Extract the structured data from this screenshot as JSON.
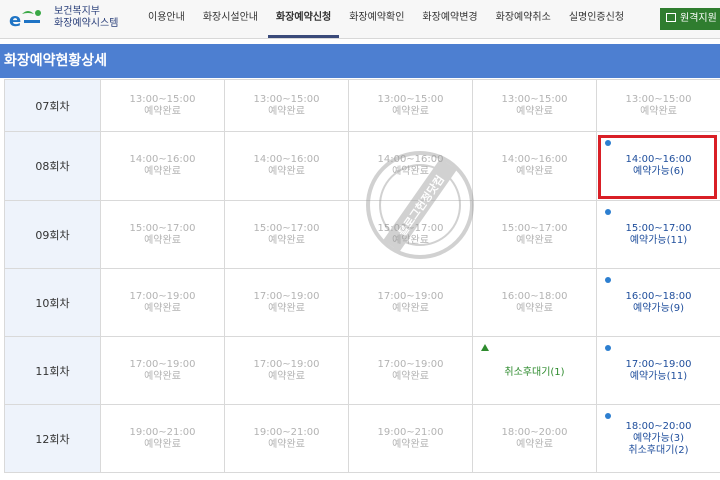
{
  "logo": {
    "line1": "보건복지부",
    "line2": "화장예약시스템"
  },
  "nav": {
    "items": [
      "이용안내",
      "화장시설안내",
      "화장예약신청",
      "화장예약확인",
      "화장예약변경",
      "화장예약취소",
      "실명인증신청"
    ],
    "active_index": 2,
    "remote_button": "원격지원"
  },
  "section": {
    "title": "화장예약현황상세"
  },
  "table": {
    "rows": [
      {
        "label": "07회차",
        "cells": [
          {
            "time": "13:00~15:00",
            "status": "예약완료"
          },
          {
            "time": "13:00~15:00",
            "status": "예약완료"
          },
          {
            "time": "13:00~15:00",
            "status": "예약완료"
          },
          {
            "time": "13:00~15:00",
            "status": "예약완료"
          },
          {
            "time": "13:00~15:00",
            "status": "예약완료"
          }
        ]
      },
      {
        "label": "08회차",
        "cells": [
          {
            "time": "14:00~16:00",
            "status": "예약완료"
          },
          {
            "time": "14:00~16:00",
            "status": "예약완료"
          },
          {
            "time": "14:00~16:00",
            "status": "예약완료"
          },
          {
            "time": "14:00~16:00",
            "status": "예약완료"
          },
          {
            "time": "14:00~16:00",
            "status": "예약가능(6)"
          }
        ]
      },
      {
        "label": "09회차",
        "cells": [
          {
            "time": "15:00~17:00",
            "status": "예약완료"
          },
          {
            "time": "15:00~17:00",
            "status": "예약완료"
          },
          {
            "time": "15:00~17:00",
            "status": "예약완료"
          },
          {
            "time": "15:00~17:00",
            "status": "예약완료"
          },
          {
            "time": "15:00~17:00",
            "status": "예약가능(11)"
          }
        ]
      },
      {
        "label": "10회차",
        "cells": [
          {
            "time": "17:00~19:00",
            "status": "예약완료"
          },
          {
            "time": "17:00~19:00",
            "status": "예약완료"
          },
          {
            "time": "17:00~19:00",
            "status": "예약완료"
          },
          {
            "time": "16:00~18:00",
            "status": "예약완료"
          },
          {
            "time": "16:00~18:00",
            "status": "예약가능(9)"
          }
        ]
      },
      {
        "label": "11회차",
        "cells": [
          {
            "time": "17:00~19:00",
            "status": "예약완료"
          },
          {
            "time": "17:00~19:00",
            "status": "예약완료"
          },
          {
            "time": "17:00~19:00",
            "status": "예약완료"
          },
          {
            "status": "취소후대기(1)"
          },
          {
            "time": "17:00~19:00",
            "status": "예약가능(11)"
          }
        ]
      },
      {
        "label": "12회차",
        "cells": [
          {
            "time": "19:00~21:00",
            "status": "예약완료"
          },
          {
            "time": "19:00~21:00",
            "status": "예약완료"
          },
          {
            "time": "19:00~21:00",
            "status": "예약완료"
          },
          {
            "time": "18:00~20:00",
            "status": "예약완료"
          },
          {
            "time": "18:00~20:00",
            "status": "예약가능(3)",
            "extra": "취소후대기(2)"
          }
        ]
      }
    ]
  },
  "watermark": "블로그헌정닷컴",
  "colors": {
    "header_blue": "#4d7fd1",
    "available_blue": "#1f4e9c",
    "dot_blue": "#2d7fd0",
    "wait_green": "#2e8b2e",
    "completed_gray": "#b3b3b3",
    "highlight_red": "#d91f26",
    "remote_green": "#2f7d2f"
  }
}
